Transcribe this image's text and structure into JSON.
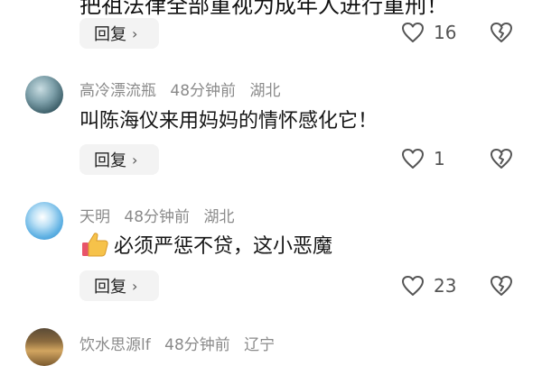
{
  "top_partial": {
    "text": "把祖法律全部重视为成年人进行重刑！",
    "reply_label": "回复",
    "like_count": "16"
  },
  "comments": [
    {
      "username": "高冷漂流瓶",
      "time": "48分钟前",
      "location": "湖北",
      "text": "叫陈海仪来用妈妈的情怀感化它！",
      "reply_label": "回复",
      "like_count": "1"
    },
    {
      "username": "天明",
      "time": "48分钟前",
      "location": "湖北",
      "emoji": "thumbs-up",
      "text": "必须严惩不贷，这小恶魔",
      "reply_label": "回复",
      "like_count": "23"
    },
    {
      "username": "饮水思源lf",
      "time": "48分钟前",
      "location": "辽宁"
    }
  ],
  "icons": {
    "like": "heart-outline-icon",
    "dislike": "broken-heart-icon",
    "reply_chevron": "chevron-right-icon"
  }
}
